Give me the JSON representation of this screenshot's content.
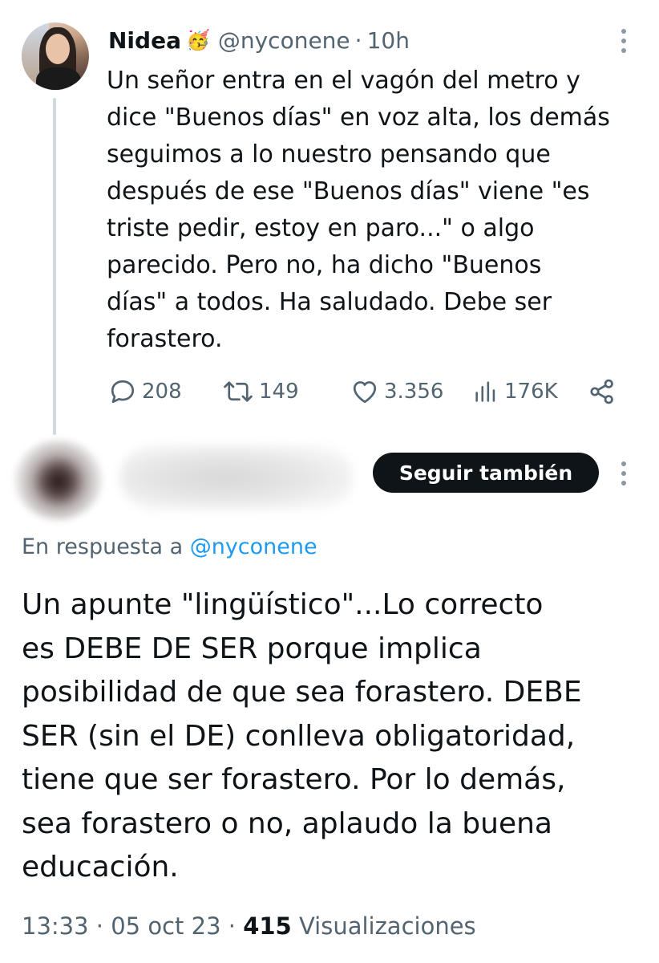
{
  "parent_tweet": {
    "display_name": "Nidea",
    "name_emoji": "🥳",
    "handle": "@nyconene",
    "separator": "·",
    "time": "10h",
    "text": "Un señor entra en el vagón del metro y\ndice \"Buenos días\" en voz alta, los demás\nseguimos a lo nuestro pensando que\ndespués de ese \"Buenos días\" viene \"es\ntriste pedir, estoy en paro...\" o algo\nparecido. Pero no, ha dicho \"Buenos\ndías\" a todos. Ha saludado. Debe ser\nforastero.",
    "actions": {
      "replies": "208",
      "retweets": "149",
      "likes": "3.356",
      "views": "176K"
    }
  },
  "reply_tweet": {
    "follow_label": "Seguir también",
    "reply_to_prefix": "En respuesta a ",
    "reply_to_handle": "@nyconene",
    "text": "Un apunte \"lingüístico\"...Lo correcto\nes DEBE DE SER porque implica\nposibilidad de que sea forastero. DEBE\nSER (sin el DE) conlleva obligatoridad,\ntiene que ser forastero. Por lo demás,\nsea forastero o no, aplaudo la buena\neducación.",
    "time": "13:33",
    "date": "05 oct 23",
    "separator": "·",
    "views_count": "415",
    "views_label": "Visualizaciones"
  },
  "colors": {
    "text_primary": "#0f1419",
    "text_secondary": "#536471",
    "link": "#1d9bf0",
    "button_bg": "#0f1419",
    "thread_line": "#cfd9de"
  }
}
